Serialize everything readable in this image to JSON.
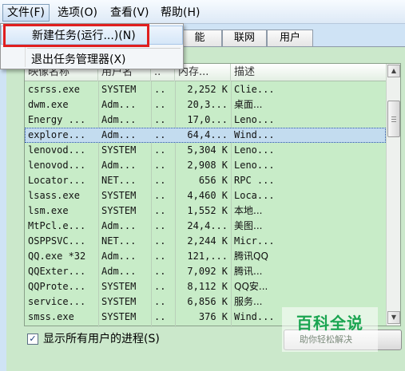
{
  "menubar": {
    "items": [
      {
        "label": "文件(F)"
      },
      {
        "label": "选项(O)"
      },
      {
        "label": "查看(V)"
      },
      {
        "label": "帮助(H)"
      }
    ]
  },
  "tabs": [
    {
      "label": "能"
    },
    {
      "label": "联网"
    },
    {
      "label": "用户"
    }
  ],
  "file_menu": {
    "items": [
      {
        "label": "新建任务(运行...)(N)"
      },
      {
        "label": "退出任务管理器(X)"
      }
    ]
  },
  "table": {
    "columns": [
      "映像名称",
      "用户名",
      "..",
      "内存...",
      "描述"
    ],
    "rows": [
      {
        "name": "csrss.exe",
        "user": "SYSTEM",
        "cpu": "..",
        "mem": "2,252 K",
        "desc": "Clie..."
      },
      {
        "name": "dwm.exe",
        "user": "Adm...",
        "cpu": "..",
        "mem": "20,3...",
        "desc": "桌面..."
      },
      {
        "name": "Energy ...",
        "user": "Adm...",
        "cpu": "..",
        "mem": "17,0...",
        "desc": "Leno..."
      },
      {
        "name": "explore...",
        "user": "Adm...",
        "cpu": "..",
        "mem": "64,4...",
        "desc": "Wind..."
      },
      {
        "name": "lenovod...",
        "user": "SYSTEM",
        "cpu": "..",
        "mem": "5,304 K",
        "desc": "Leno..."
      },
      {
        "name": "lenovod...",
        "user": "Adm...",
        "cpu": "..",
        "mem": "2,908 K",
        "desc": "Leno..."
      },
      {
        "name": "Locator...",
        "user": "NET...",
        "cpu": "..",
        "mem": "656 K",
        "desc": "RPC ..."
      },
      {
        "name": "lsass.exe",
        "user": "SYSTEM",
        "cpu": "..",
        "mem": "4,460 K",
        "desc": "Loca..."
      },
      {
        "name": "lsm.exe",
        "user": "SYSTEM",
        "cpu": "..",
        "mem": "1,552 K",
        "desc": "本地..."
      },
      {
        "name": "MtPcl.e...",
        "user": "Adm...",
        "cpu": "..",
        "mem": "24,4...",
        "desc": "美图..."
      },
      {
        "name": "OSPPSVC...",
        "user": "NET...",
        "cpu": "..",
        "mem": "2,244 K",
        "desc": "Micr..."
      },
      {
        "name": "QQ.exe *32",
        "user": "Adm...",
        "cpu": "..",
        "mem": "121,...",
        "desc": "腾讯QQ"
      },
      {
        "name": "QQExter...",
        "user": "Adm...",
        "cpu": "..",
        "mem": "7,092 K",
        "desc": "腾讯..."
      },
      {
        "name": "QQProte...",
        "user": "SYSTEM",
        "cpu": "..",
        "mem": "8,112 K",
        "desc": "QQ安..."
      },
      {
        "name": "service...",
        "user": "SYSTEM",
        "cpu": "..",
        "mem": "6,856 K",
        "desc": "服务..."
      },
      {
        "name": "smss.exe",
        "user": "SYSTEM",
        "cpu": "..",
        "mem": "376 K",
        "desc": "Wind..."
      }
    ],
    "selected_row": "explore..."
  },
  "footer": {
    "show_all_users_label": "显示所有用户的进程(S)",
    "show_all_users_checked": "✓"
  },
  "watermark": {
    "title": "百科全说",
    "subtitle": "助你轻松解决"
  }
}
